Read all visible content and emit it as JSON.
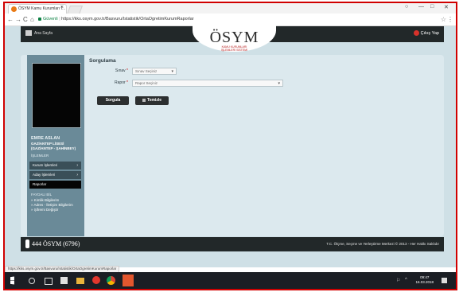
{
  "browser": {
    "tab_title": "ÖSYM Kamu Kurumları İ...",
    "tab_close": "×",
    "url_secure_label": "Güvenli",
    "url": "https://kks.osym.gov.tr/Basvuru/Istatistik/OrtaOgretimKurumRaporlar",
    "nav_back": "←",
    "nav_forward": "→",
    "nav_reload": "C",
    "nav_home": "⌂",
    "star": "☆",
    "menu": "⋮",
    "win_min": "—",
    "win_max": "□",
    "win_close": "✕"
  },
  "header": {
    "home_link": "Ana Sayfa",
    "logout_link": "Çıkış Yap",
    "logo_text": "ÖSYM",
    "logo_subtitle_1": "KAMU KURUMLARI",
    "logo_subtitle_2": "İŞLEMLERİ SİSTEMİ"
  },
  "sidebar": {
    "user_name": "EMRE ASLAN",
    "school": "GAZİANTEP LİSESİ (GAZİANTEP - ŞAHİNBEY)",
    "section_title": "İŞLEMLER",
    "items": [
      {
        "label": "Kurum İşlemleri",
        "arrow": "›"
      },
      {
        "label": "Aday İşlemleri",
        "arrow": "›"
      },
      {
        "label": "Raporlar",
        "arrow": ""
      }
    ],
    "links_title": "FAYDALI BİL",
    "links": [
      "» Kimlik Bilgilerim",
      "» Adres - İletişim Bilgilerim",
      "» Şifremi Değiştir"
    ]
  },
  "main": {
    "title": "Sorgulama",
    "sinav_label": "Sınav",
    "sinav_placeholder": "Sınav Seçiniz",
    "rapor_label": "Rapor",
    "rapor_placeholder": "Rapor Seçiniz",
    "required_mark": "*",
    "caret": "▾",
    "query_button": "Sorgula",
    "clear_button": "Temizle"
  },
  "footer": {
    "phone": "444 ÖSYM (6796)",
    "copyright": "T.C. Ölçme, Seçme ve Yerleştirme Merkezi © 2013 - Her Hakkı Saklıdır"
  },
  "status_url": "https://kks.osym.gov.tr/Basvuru/Istatistik/OrtaOgretimKurumRaporlar",
  "taskbar": {
    "time": "09:47",
    "date": "16.03.2018"
  }
}
